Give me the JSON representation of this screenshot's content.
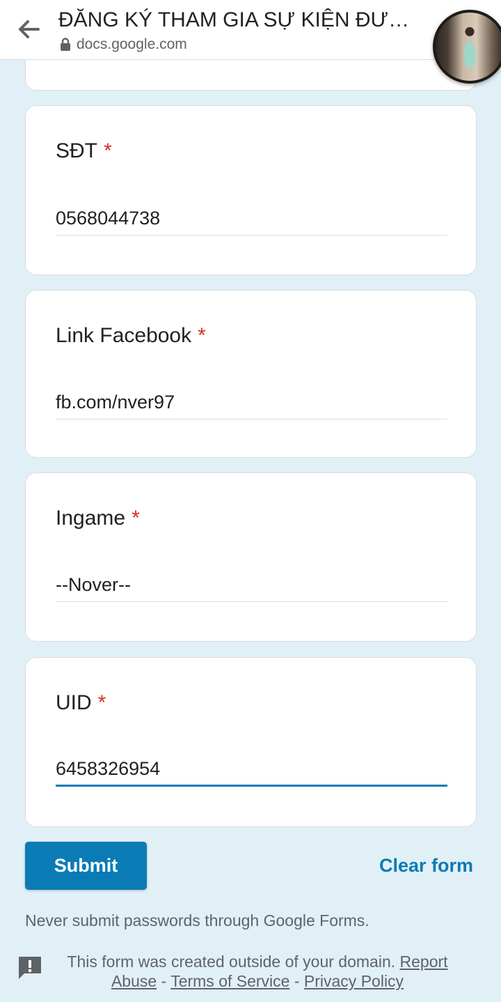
{
  "header": {
    "page_title": "ĐĂNG KÝ THAM GIA SỰ KIỆN ĐƯỜ...",
    "url": "docs.google.com"
  },
  "questions": [
    {
      "label": "SĐT",
      "required_mark": "*",
      "value": "0568044738"
    },
    {
      "label": "Link Facebook",
      "required_mark": "*",
      "value": "fb.com/nver97"
    },
    {
      "label": "Ingame",
      "required_mark": "*",
      "value": "--Nover--"
    },
    {
      "label": "UID",
      "required_mark": "*",
      "value": "6458326954"
    }
  ],
  "actions": {
    "submit_label": "Submit",
    "clear_label": "Clear form"
  },
  "warning_text": "Never submit passwords through Google Forms.",
  "footer": {
    "notice": "This form was created outside of your domain.",
    "report_abuse": "Report Abuse",
    "sep1": " - ",
    "terms": "Terms of Service",
    "sep2": " - ",
    "privacy": "Privacy Policy"
  },
  "colors": {
    "background": "#e1f0f7",
    "accent": "#0b7bb5",
    "required": "#d93025"
  }
}
